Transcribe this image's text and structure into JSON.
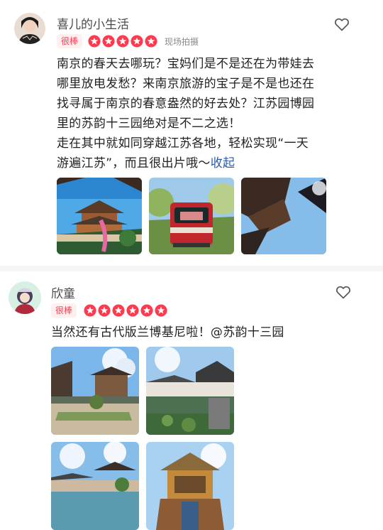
{
  "reviews": [
    {
      "username": "喜儿的小生活",
      "badge": "很棒",
      "tag": "现场拍摄",
      "text_lines": [
        "南京的春天去哪玩？宝妈们是不是还在为带娃去",
        "哪里放电发愁？来南京旅游的宝子是不是也还在",
        "找寻属于南京的春意盎然的好去处？江苏园博园",
        "里的苏韵十三园绝对是不二之选！",
        "走在其中就如同穿越江苏各地，轻松实现“一天",
        "游遍江苏”，而且很出片哦～"
      ],
      "collapse_label": "收起",
      "rating": 5
    },
    {
      "username": "欣童",
      "badge": "很棒",
      "text": "当然还有古代版兰博基尼啦！@苏韵十三园",
      "rating": 5
    }
  ],
  "colors": {
    "accent": "#ff3a4f",
    "link": "#2b5aa8"
  },
  "icons": {
    "like": "heart-outline-icon",
    "star": "star-filled-icon"
  }
}
